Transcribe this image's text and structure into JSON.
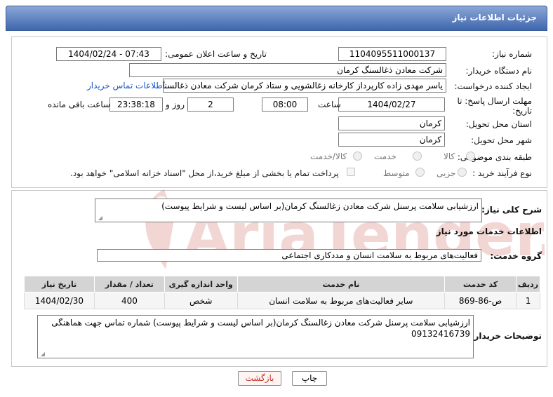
{
  "header": {
    "title": "جزئیات اطلاعات نیاز"
  },
  "form": {
    "need_number_label": "شماره نیاز:",
    "need_number": "1104095511000137",
    "announce_label": "تاریخ و ساعت اعلان عمومی:",
    "announce_value": "1404/02/24 - 07:43",
    "buyer_label": "نام دستگاه خریدار:",
    "buyer_value": "شرکت معادن ذغالسنگ کرمان",
    "creator_label": "ایجاد کننده درخواست:",
    "creator_value": "یاسر مهدی زاده کارپرداز کارخانه زغالشویی و ستاد کرمان شرکت معادن ذغالسنگ کرمان",
    "contact_link": "اطلاعات تماس خریدار",
    "deadline_label_1": "مهلت ارسال پاسخ: تا",
    "deadline_label_2": "تاریخ:",
    "deadline_date": "1404/02/27",
    "time_label": "ساعت",
    "deadline_time": "08:00",
    "days_value": "2",
    "days_label": "روز و",
    "remaining_time": "23:38:18",
    "remaining_label": "ساعت باقی مانده",
    "province_label": "استان محل تحویل:",
    "province_value": "کرمان",
    "city_label": "شهر محل تحویل:",
    "city_value": "کرمان",
    "category_label": "طبقه بندی موضوعی:",
    "category_options": [
      "کالا",
      "خدمت",
      "کالا/خدمت"
    ],
    "process_label": "نوع فرآیند خرید :",
    "process_options": [
      "جزیی",
      "متوسط"
    ],
    "payment_note": "پرداخت تمام یا بخشی از مبلغ خرید،از محل \"اسناد خزانه اسلامی\" خواهد بود."
  },
  "details": {
    "summary_label": "شرح کلی نیاز:",
    "summary_value": "ارزشیابی سلامت پرسنل شرکت معادن زغالسنگ کرمان(بر اساس لیست و شرایط پیوست)",
    "services_heading": "اطلاعات خدمات مورد نیاز",
    "group_label": "گروه خدمت:",
    "group_value": "فعالیت‌های مربوط به سلامت انسان و مددکاری اجتماعی",
    "table": {
      "headers": [
        "ردیف",
        "کد خدمت",
        "نام خدمت",
        "واحد اندازه گیری",
        "تعداد / مقدار",
        "تاریخ نیاز"
      ],
      "rows": [
        [
          "1",
          "ص-86-869",
          "سایر فعالیت‌های مربوط به سلامت انسان",
          "شخص",
          "400",
          "1404/02/30"
        ]
      ]
    },
    "buyer_notes_label": "توضیحات خریدار:",
    "buyer_notes_value": "ارزشیابی سلامت پرسنل شرکت معادن زغالسنگ کرمان(بر اساس لیست و شرایط پیوست) شماره تماس جهت هماهنگی 09132416739"
  },
  "buttons": {
    "print": "چاپ",
    "back": "بازگشت"
  },
  "watermark": {
    "text": "AriaTender.neT"
  },
  "colors": {
    "header_top": "#8aa6d6",
    "header_bottom": "#3f67ae",
    "link": "#1a56c8",
    "back_text": "#c0392b",
    "watermark": "#c0392b"
  }
}
